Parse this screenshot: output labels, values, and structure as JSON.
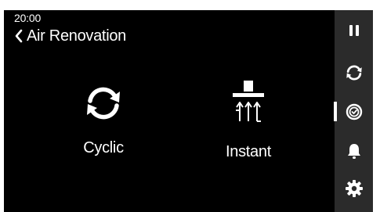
{
  "status": {
    "time": "20:00"
  },
  "header": {
    "back_icon": "chevron-left-icon",
    "title": "Air Renovation"
  },
  "modes": [
    {
      "label": "Cyclic",
      "icon": "cycle-arrows-icon"
    },
    {
      "label": "Instant",
      "icon": "hood-extraction-icon"
    }
  ],
  "sidebar": {
    "items": [
      {
        "icon": "pause-icon"
      },
      {
        "icon": "cycle-icon"
      },
      {
        "icon": "timer-icon",
        "active": true
      },
      {
        "icon": "bell-icon"
      },
      {
        "icon": "gear-icon"
      }
    ]
  },
  "colors": {
    "background": "#000000",
    "sidebar": "#2b2b2b",
    "foreground": "#ffffff"
  }
}
